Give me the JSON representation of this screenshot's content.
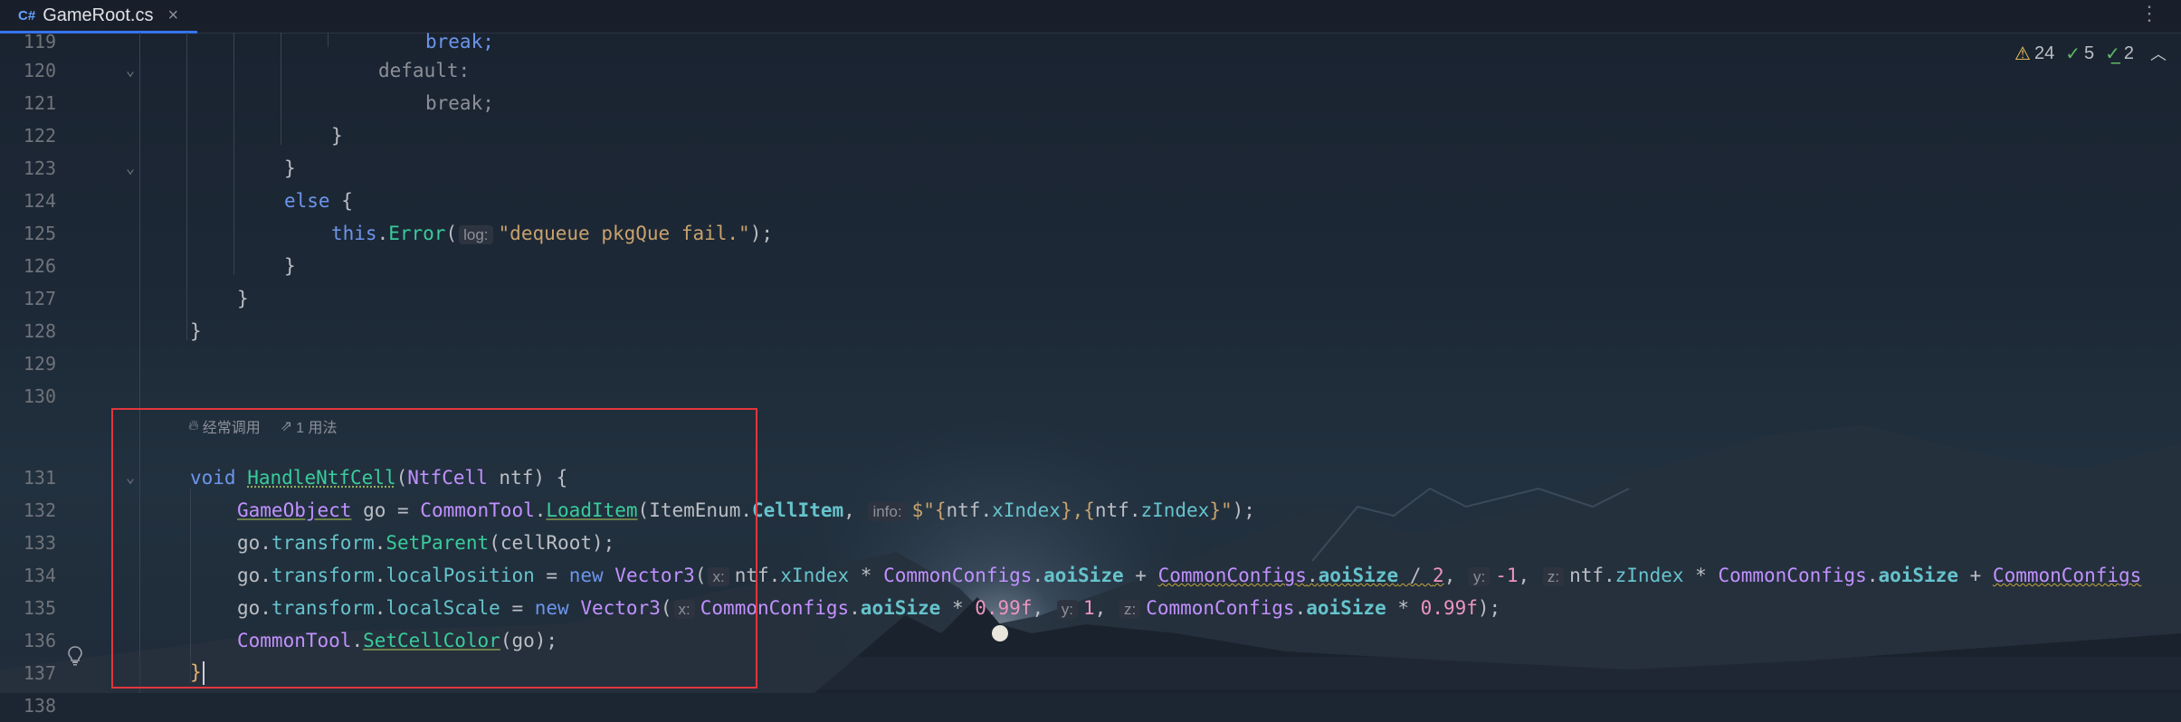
{
  "tab": {
    "lang": "C#",
    "title": "GameRoot.cs",
    "close": "×"
  },
  "tab_menu_icon": "⋮",
  "status": {
    "warnings": "24",
    "checks": "5",
    "double_checks": "2"
  },
  "code_lens": {
    "usage_hint": "经常调用",
    "usages": "1 用法"
  },
  "lines": {
    "l119": {
      "num": "119",
      "text": "break;"
    },
    "l120": {
      "num": "120",
      "text": "default:"
    },
    "l121": {
      "num": "121",
      "text": "break;"
    },
    "l122": {
      "num": "122",
      "text": "}"
    },
    "l123": {
      "num": "123",
      "text": "}"
    },
    "l124": {
      "num": "124",
      "kw": "else",
      "rest": " {"
    },
    "l125": {
      "num": "125",
      "this": "this",
      "dot": ".",
      "method": "Error",
      "open": "(",
      "hint": "log:",
      "str": "\"dequeue pkgQue fail.\"",
      "close": ");"
    },
    "l126": {
      "num": "126",
      "text": "}"
    },
    "l127": {
      "num": "127",
      "text": "}"
    },
    "l128": {
      "num": "128",
      "text": "}"
    },
    "l129": {
      "num": "129"
    },
    "l130": {
      "num": "130"
    },
    "l131": {
      "num": "131",
      "kw": "void",
      "method": "HandleNtfCell",
      "open": "(",
      "type": "NtfCell",
      "rest": " ntf) {"
    },
    "l132": {
      "num": "132",
      "type": "GameObject",
      "t1": " go = ",
      "cls": "CommonTool",
      "dot": ".",
      "method": "LoadItem",
      "t2": "(ItemEnum.",
      "field": "CellItem",
      "t3": ", ",
      "hint": "info:",
      "str1": "$\"{",
      "t4": "ntf.",
      "prop1": "xIndex",
      "str2": "},{",
      "t5": "ntf.",
      "prop2": "zIndex",
      "str3": "}\"",
      "close": ");"
    },
    "l133": {
      "num": "133",
      "t1": "go.",
      "prop": "transform",
      "dot": ".",
      "method": "SetParent",
      "rest": "(cellRoot);"
    },
    "l134": {
      "num": "134",
      "t1": "go.",
      "prop1": "transform",
      "dot": ".",
      "prop2": "localPosition",
      "t2": " = ",
      "kw": "new",
      "t3": " ",
      "cls": "Vector3",
      "open": "(",
      "hx": "x:",
      "t4": "ntf.",
      "p3": "xIndex",
      "t5": " * ",
      "cc1": "CommonConfigs",
      "d1": ".",
      "p4": "aoiSize",
      "t6": " + ",
      "cc2": "CommonConfigs",
      "d2": ".",
      "p5": "aoiSize",
      "t7": " / ",
      "n1": "2",
      "t8": ", ",
      "hy": "y:",
      "n2": "-1",
      "t9": ", ",
      "hz": "z:",
      "t10": "ntf.",
      "p6": "zIndex",
      "t11": " * ",
      "cc3": "CommonConfigs",
      "d3": ".",
      "p7": "aoiSize",
      "t12": " + ",
      "cc4": "CommonConfigs"
    },
    "l135": {
      "num": "135",
      "t1": "go.",
      "prop1": "transform",
      "dot": ".",
      "prop2": "localScale",
      "t2": " = ",
      "kw": "new",
      "t3": " ",
      "cls": "Vector3",
      "open": "(",
      "hx": "x:",
      "cc1": "CommonConfigs",
      "d1": ".",
      "p3": "aoiSize",
      "t4": " * ",
      "n1": "0.99f",
      "t5": ", ",
      "hy": "y:",
      "n2": "1",
      "t6": ", ",
      "hz": "z:",
      "cc2": "CommonConfigs",
      "d2": ".",
      "p4": "aoiSize",
      "t7": " * ",
      "n3": "0.99f",
      "close": ");"
    },
    "l136": {
      "num": "136",
      "cls": "CommonTool",
      "dot": ".",
      "method": "SetCellColor",
      "rest": "(go);"
    },
    "l137": {
      "num": "137",
      "text": "}"
    },
    "l138": {
      "num": "138"
    }
  }
}
